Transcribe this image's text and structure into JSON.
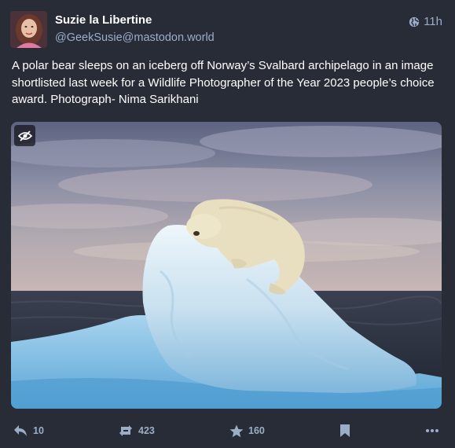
{
  "post": {
    "display_name": "Suzie la Libertine",
    "account": "@GeekSusie@mastodon.world",
    "timestamp": "11h",
    "visibility_icon": "globe-icon",
    "content": "A polar bear sleeps on an iceberg off Norway’s Svalbard archipelago in an image shortlisted last week for a Wildlife Photographer of the Year 2023 people’s choice award. Photograph- Nima Sarikhani",
    "media": {
      "sensitive_toggle_icon": "eye-slash-icon"
    }
  },
  "actions": {
    "reply_count": "10",
    "boost_count": "423",
    "favourite_count": "160"
  },
  "colors": {
    "background": "#282c37",
    "secondary_text": "#9baec8",
    "primary_text": "#ffffff"
  }
}
